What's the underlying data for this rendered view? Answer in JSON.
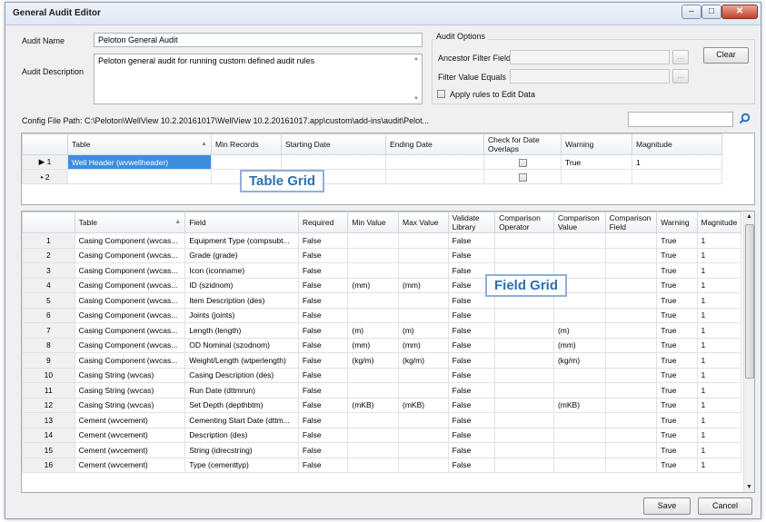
{
  "window": {
    "title": "General Audit Editor"
  },
  "form": {
    "audit_name_label": "Audit Name",
    "audit_name_value": "Peloton General Audit",
    "audit_desc_label": "Audit Description",
    "audit_desc_value": "Peloton general audit for running custom defined audit rules",
    "config_label": "Config File Path:",
    "config_value": "C:\\Peloton\\WellView 10.2.20161017\\WellView 10.2.20161017.app\\custom\\add-ins\\audit\\Pelot..."
  },
  "options": {
    "title": "Audit Options",
    "ancestor_label": "Ancestor Filter Field",
    "filter_label": "Filter Value Equals",
    "browse1": "...",
    "browse2": "...",
    "clear": "Clear",
    "apply_label": "Apply rules to Edit Data"
  },
  "table_grid": {
    "callout": "Table Grid",
    "headers": [
      "Table",
      "Min Records",
      "Starting Date",
      "Ending Date",
      "Check for Date Overlaps",
      "Warning",
      "Magnitude"
    ],
    "rows": [
      {
        "marker": "▶",
        "num": "1",
        "table": "Well Header (wvwellheader)",
        "warning": "True",
        "magnitude": "1"
      },
      {
        "marker": "•",
        "num": "2",
        "table": "",
        "warning": "",
        "magnitude": ""
      }
    ]
  },
  "field_grid": {
    "callout": "Field Grid",
    "headers": [
      "Table",
      "Field",
      "Required",
      "Min Value",
      "Max Value",
      "Validate Library",
      "Comparison Operator",
      "Comparison Value",
      "Comparison Field",
      "Warning",
      "Magnitude"
    ],
    "rows": [
      [
        "1",
        "Casing Component (wvcas...",
        "Equipment Type (compsubt...",
        "False",
        "",
        "",
        "False",
        "",
        "",
        "",
        "True",
        "1"
      ],
      [
        "2",
        "Casing Component (wvcas...",
        "Grade (grade)",
        "False",
        "",
        "",
        "False",
        "",
        "",
        "",
        "True",
        "1"
      ],
      [
        "3",
        "Casing Component (wvcas...",
        "Icon (iconname)",
        "False",
        "",
        "",
        "False",
        "",
        "",
        "",
        "True",
        "1"
      ],
      [
        "4",
        "Casing Component (wvcas...",
        "ID (szidnom)",
        "False",
        "(mm)",
        "(mm)",
        "False",
        "",
        "",
        "",
        "True",
        "1"
      ],
      [
        "5",
        "Casing Component (wvcas...",
        "Item Description (des)",
        "False",
        "",
        "",
        "False",
        "",
        "",
        "",
        "True",
        "1"
      ],
      [
        "6",
        "Casing Component (wvcas...",
        "Joints (joints)",
        "False",
        "",
        "",
        "False",
        "",
        "",
        "",
        "True",
        "1"
      ],
      [
        "7",
        "Casing Component (wvcas...",
        "Length (length)",
        "False",
        "(m)",
        "(m)",
        "False",
        "",
        "(m)",
        "",
        "True",
        "1"
      ],
      [
        "8",
        "Casing Component (wvcas...",
        "OD Nominal (szodnom)",
        "False",
        "(mm)",
        "(mm)",
        "False",
        "",
        "(mm)",
        "",
        "True",
        "1"
      ],
      [
        "9",
        "Casing Component (wvcas...",
        "Weight/Length (wtperlength)",
        "False",
        "(kg/m)",
        "(kg/m)",
        "False",
        "",
        "(kg/m)",
        "",
        "True",
        "1"
      ],
      [
        "10",
        "Casing String (wvcas)",
        "Casing Description (des)",
        "False",
        "",
        "",
        "False",
        "",
        "",
        "",
        "True",
        "1"
      ],
      [
        "11",
        "Casing String (wvcas)",
        "Run Date (dttmrun)",
        "False",
        "",
        "",
        "False",
        "",
        "",
        "",
        "True",
        "1"
      ],
      [
        "12",
        "Casing String (wvcas)",
        "Set Depth (depthbtm)",
        "False",
        "(mKB)",
        "(mKB)",
        "False",
        "",
        "(mKB)",
        "",
        "True",
        "1"
      ],
      [
        "13",
        "Cement (wvcement)",
        "Cementing Start Date (dttm...",
        "False",
        "",
        "",
        "False",
        "",
        "",
        "",
        "True",
        "1"
      ],
      [
        "14",
        "Cement (wvcement)",
        "Description (des)",
        "False",
        "",
        "",
        "False",
        "",
        "",
        "",
        "True",
        "1"
      ],
      [
        "15",
        "Cement (wvcement)",
        "String (idrecstring)",
        "False",
        "",
        "",
        "False",
        "",
        "",
        "",
        "True",
        "1"
      ],
      [
        "16",
        "Cement (wvcement)",
        "Type (cementtyp)",
        "False",
        "",
        "",
        "False",
        "",
        "",
        "",
        "True",
        "1"
      ]
    ]
  },
  "footer": {
    "save": "Save",
    "cancel": "Cancel"
  },
  "colors": {
    "callout_text": "#2f6fad",
    "callout_border": "#8fb0d8",
    "search_icon": "#1f6fc7"
  }
}
